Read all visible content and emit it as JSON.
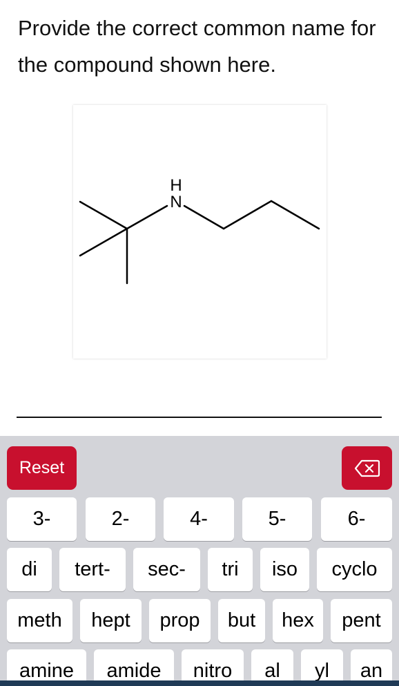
{
  "question": "Provide the correct common name for the compound shown here.",
  "structure": {
    "atom_label_n": "N",
    "atom_label_h": "H"
  },
  "keyboard": {
    "reset_label": "Reset",
    "backspace_icon": "backspace-icon",
    "rows": [
      [
        "3-",
        "2-",
        "4-",
        "5-",
        "6-"
      ],
      [
        "di",
        "tert-",
        "sec-",
        "tri",
        "iso",
        "cyclo"
      ],
      [
        "meth",
        "hept",
        "prop",
        "but",
        "hex",
        "pent"
      ],
      [
        "amine",
        "amide",
        "nitro",
        "al",
        "yl",
        "an"
      ]
    ]
  },
  "colors": {
    "accent_red": "#c8102e",
    "keyboard_bg": "#d3d4d9",
    "key_bg": "#ffffff"
  }
}
